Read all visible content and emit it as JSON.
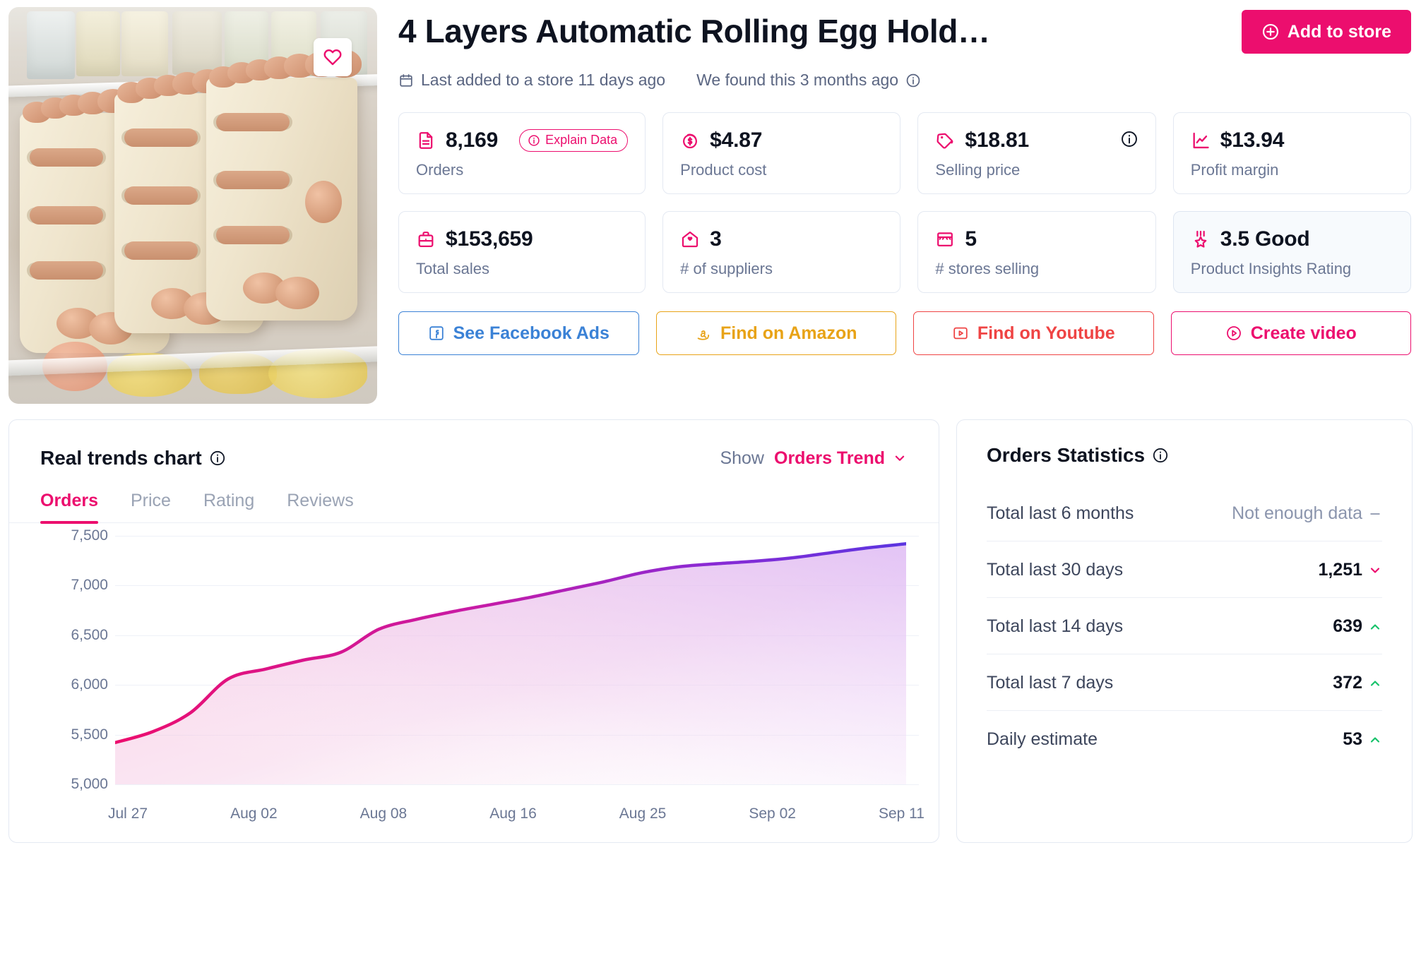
{
  "product": {
    "title": "4 Layers Automatic Rolling Egg Hold…",
    "favorite_icon": "heart-icon",
    "add_to_store_label": "Add to store",
    "add_to_store_icon": "plus-circle-icon",
    "meta": [
      {
        "icon": "calendar-icon",
        "text": "Last added to a store 11 days ago"
      },
      {
        "icon": "",
        "text": "We found this 3 months ago",
        "trailing_icon": "info-icon"
      }
    ]
  },
  "metrics": [
    {
      "icon": "document-icon",
      "value": "8,169",
      "label": "Orders",
      "pill": "Explain Data",
      "pill_icon": "info-icon"
    },
    {
      "icon": "coin-icon",
      "value": "$4.87",
      "label": "Product cost"
    },
    {
      "icon": "tag-icon",
      "value": "$18.81",
      "label": "Selling price",
      "corner_icon": "info-icon"
    },
    {
      "icon": "chart-up-icon",
      "value": "$13.94",
      "label": "Profit margin"
    },
    {
      "icon": "briefcase-icon",
      "value": "$153,659",
      "label": "Total sales"
    },
    {
      "icon": "supplier-icon",
      "value": "3",
      "label": "# of suppliers"
    },
    {
      "icon": "store-icon",
      "value": "5",
      "label": "# stores selling"
    },
    {
      "icon": "medal-icon",
      "value": "3.5 Good",
      "label": "Product Insights Rating",
      "highlight": true
    }
  ],
  "actions": [
    {
      "label": "See Facebook Ads",
      "icon": "facebook-icon",
      "style": "act-fb"
    },
    {
      "label": "Find on Amazon",
      "icon": "amazon-icon",
      "style": "act-az"
    },
    {
      "label": "Find on Youtube",
      "icon": "youtube-icon",
      "style": "act-yt"
    },
    {
      "label": "Create video",
      "icon": "play-circle-icon",
      "style": "act-cv"
    }
  ],
  "chart_panel": {
    "title": "Real trends chart",
    "title_icon": "info-icon",
    "show_label": "Show",
    "show_value": "Orders Trend",
    "show_caret": "chevron-down-icon",
    "tabs": [
      {
        "label": "Orders",
        "active": true
      },
      {
        "label": "Price",
        "active": false
      },
      {
        "label": "Rating",
        "active": false
      },
      {
        "label": "Reviews",
        "active": false
      }
    ]
  },
  "chart_data": {
    "type": "area",
    "title": "Real trends chart",
    "xlabel": "",
    "ylabel": "Orders",
    "ylim": [
      5000,
      7500
    ],
    "yticks": [
      7500,
      7000,
      6500,
      6000,
      5500,
      5000
    ],
    "ytick_labels": [
      "7,500",
      "7,000",
      "6,500",
      "6,000",
      "5,500",
      "5,000"
    ],
    "grid": true,
    "legend": "none",
    "categories": [
      "Jul 27",
      "Aug 02",
      "Aug 08",
      "Aug 16",
      "Aug 25",
      "Sep 02",
      "Sep 11"
    ],
    "xtick_labels": [
      "Jul 27",
      "Aug 02",
      "Aug 08",
      "Aug 16",
      "Aug 25",
      "Sep 02",
      "Sep 11"
    ],
    "series": [
      {
        "name": "Orders Trend",
        "line_color_start": "#ec0e6e",
        "line_color_end": "#5b35e0",
        "x": [
          "Jul 27",
          "Jul 29",
          "Jul 31",
          "Aug 02",
          "Aug 04",
          "Aug 06",
          "Aug 08",
          "Aug 10",
          "Aug 12",
          "Aug 14",
          "Aug 16",
          "Aug 18",
          "Aug 20",
          "Aug 22",
          "Aug 25",
          "Aug 27",
          "Aug 29",
          "Sep 02",
          "Sep 04",
          "Sep 06",
          "Sep 08",
          "Sep 11"
        ],
        "values": [
          5420,
          5530,
          5720,
          6060,
          6160,
          6250,
          6330,
          6560,
          6660,
          6740,
          6810,
          6880,
          6960,
          7040,
          7130,
          7190,
          7220,
          7245,
          7280,
          7330,
          7380,
          7420
        ]
      }
    ]
  },
  "stats": {
    "title": "Orders Statistics",
    "title_icon": "info-icon",
    "rows": [
      {
        "name": "Total last 6 months",
        "value": "Not enough data",
        "trend": "flat",
        "muted": true
      },
      {
        "name": "Total last 30 days",
        "value": "1,251",
        "trend": "down",
        "muted": false
      },
      {
        "name": "Total last 14 days",
        "value": "639",
        "trend": "up",
        "muted": false
      },
      {
        "name": "Total last 7 days",
        "value": "372",
        "trend": "up",
        "muted": false
      },
      {
        "name": "Daily estimate",
        "value": "53",
        "trend": "up",
        "muted": false
      }
    ]
  },
  "colors": {
    "accent": "#ec0e6e",
    "up": "#17c26a",
    "text": "#0e1320",
    "muted": "#6b7794"
  }
}
